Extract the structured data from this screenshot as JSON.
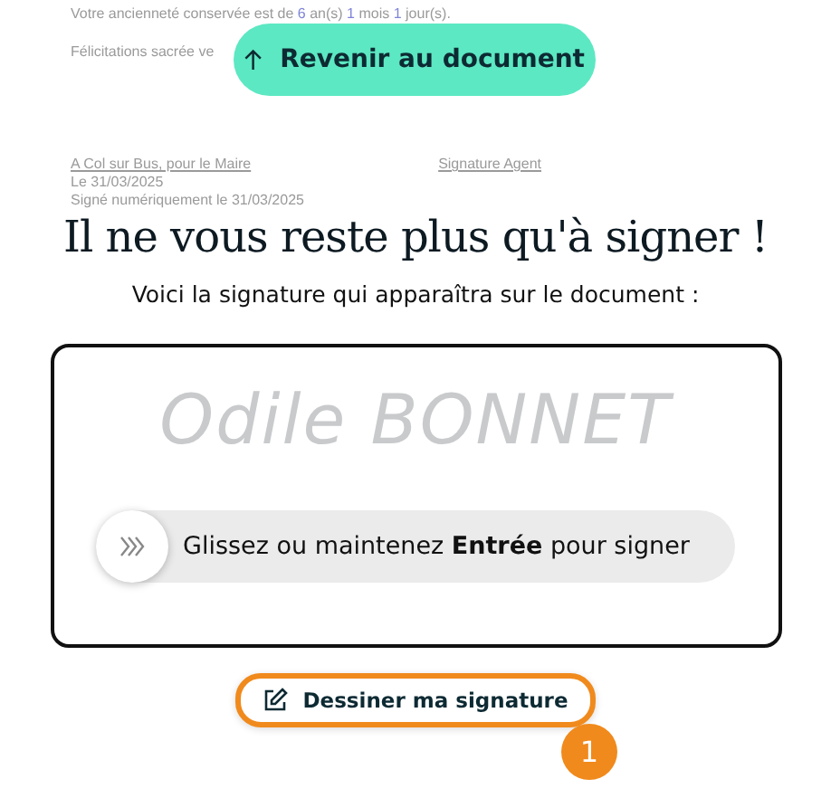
{
  "document": {
    "seniority": [
      {
        "text": "Votre ancienneté conservée est de ",
        "field": false
      },
      {
        "text": "6",
        "field": true
      },
      {
        "text": " an(s) ",
        "field": false
      },
      {
        "text": "1",
        "field": true
      },
      {
        "text": " mois ",
        "field": false
      },
      {
        "text": "1",
        "field": true
      },
      {
        "text": " jour(s).",
        "field": false
      }
    ],
    "congrats": "Félicitations sacrée ve",
    "place": "A Col sur Bus, pour le Maire",
    "agent_label": "Signature Agent",
    "date": "Le 31/03/2025",
    "signed": "Signé numériquement le 31/03/2025"
  },
  "back_button": {
    "label": "Revenir au document"
  },
  "title": "Il ne vous reste plus qu'à signer !",
  "subtitle": "Voici la signature qui apparaîtra sur le document :",
  "signature": {
    "name": "Odile BONNET"
  },
  "slider": {
    "label": "Glissez ou maintenez **Entrée** pour signer",
    "level": 0
  },
  "draw_button": {
    "label": "Dessiner ma signature",
    "highlighted": true
  },
  "step_badge": "1"
}
